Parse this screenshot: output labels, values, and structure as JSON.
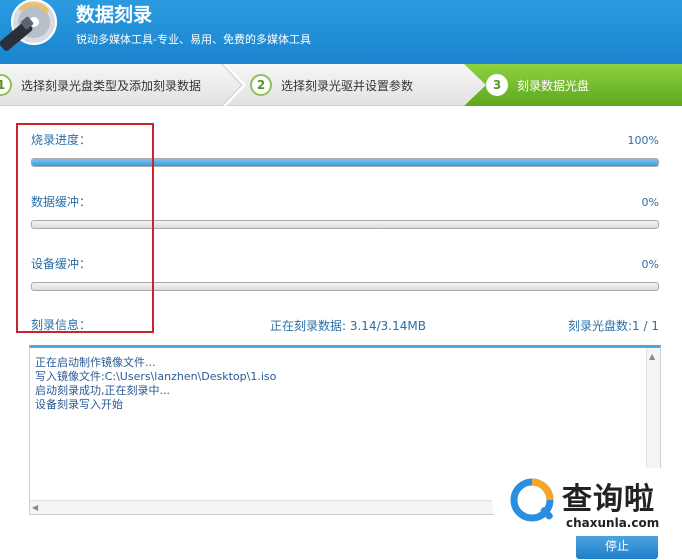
{
  "app": {
    "title": "数据刻录",
    "subtitle": "锐动多媒体工具-专业、易用、免费的多媒体工具"
  },
  "steps": [
    {
      "num": "1",
      "label": "选择刻录光盘类型及添加刻录数据",
      "active": false
    },
    {
      "num": "2",
      "label": "选择刻录光驱并设置参数",
      "active": false
    },
    {
      "num": "3",
      "label": "刻录数据光盘",
      "active": true
    }
  ],
  "progress": {
    "burn": {
      "label": "烧录进度：",
      "percent_text": "100%",
      "value": 1.0
    },
    "data_buffer": {
      "label": "数据缓冲：",
      "percent_text": "0%",
      "value": 0.0
    },
    "device_buffer": {
      "label": "设备缓冲：",
      "percent_text": "0%",
      "value": 0.0
    }
  },
  "info": {
    "label": "刻录信息：",
    "burning_data": "正在刻录数据: 3.14/3.14MB",
    "disc_count": "刻录光盘数:1 / 1"
  },
  "log": [
    "正在启动制作镜像文件...",
    "写入镜像文件:C:\\Users\\lanzhen\\Desktop\\1.iso",
    "启动刻录成功,正在刻录中...",
    "设备刻录写入开始"
  ],
  "buttons": {
    "stop": "停止"
  },
  "watermark": {
    "text": "查询啦",
    "url": "chaxunla.com"
  },
  "colors": {
    "header": "#1a84cf",
    "active_step": "#5da81d",
    "progress_fill": "#3a9bd8",
    "highlight_box": "#c8262b"
  }
}
